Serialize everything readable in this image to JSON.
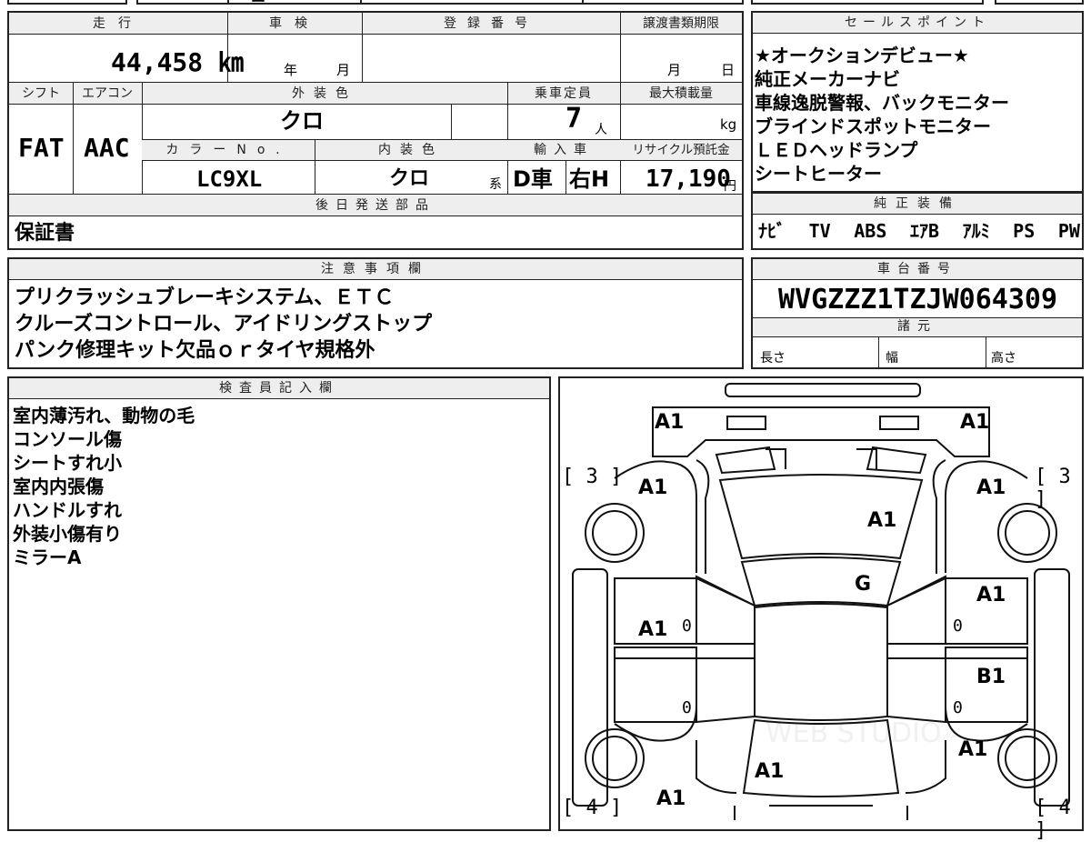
{
  "top_strip": {
    "partial_text": "ー"
  },
  "vehicle": {
    "mileage_label": "走行",
    "mileage_value": "44,458 ㎞",
    "inspection_label": "車検",
    "inspection_year": "年",
    "inspection_month": "月",
    "registration_label": "登録番号",
    "transfer_label": "譲渡書類期限",
    "transfer_month": "月",
    "transfer_day": "日",
    "shift_label": "シフト",
    "shift_value": "FAT",
    "ac_label": "エアコン",
    "ac_value": "AAC",
    "exterior_color_label": "外装色",
    "exterior_color_value": "クロ",
    "capacity_label": "乗車定員",
    "capacity_value": "7",
    "capacity_unit": "人",
    "max_load_label": "最大積載量",
    "max_load_unit": "kg",
    "color_no_label": "カラーNo.",
    "color_no_value": "LC9XL",
    "interior_color_label": "内装色",
    "interior_color_value": "クロ",
    "interior_color_suffix": "系",
    "import_label": "輸入車",
    "import_type": "D車",
    "steering": "右H",
    "recycle_label": "リサイクル預託金",
    "recycle_value": "17,190",
    "recycle_unit": "円",
    "later_parts_label": "後日発送部品",
    "later_parts_value": "保証書"
  },
  "sales_points": {
    "label": "セールスポイント",
    "lines": [
      "★オークションデビュー★",
      "純正メーカーナビ",
      "車線逸脱警報、バックモニター",
      "ブラインドスポットモニター",
      "ＬＥＤヘッドランプ",
      "シートヒーター"
    ]
  },
  "equipment": {
    "label": "純正装備",
    "items": [
      "ﾅﾋﾞ",
      "TV",
      "ABS",
      "ｴｱB",
      "ｱﾙﾐ",
      "PS",
      "PW"
    ]
  },
  "notes": {
    "label": "注意事項欄",
    "lines": [
      "プリクラッシュブレーキシステム、ＥＴＣ",
      "クルーズコントロール、アイドリングストップ",
      "パンク修理キット欠品ｏｒタイヤ規格外"
    ]
  },
  "chassis": {
    "label": "車台番号",
    "value": "WVGZZZ1TZJW064309"
  },
  "specs": {
    "label": "諸元",
    "length": "長さ",
    "width": "幅",
    "height": "高さ"
  },
  "inspector": {
    "label": "検査員記入欄",
    "lines": [
      "室内薄汚れ、動物の毛",
      "コンソール傷",
      "シートすれ小",
      "室内内張傷",
      "ハンドルすれ",
      "外装小傷有り",
      "ミラーA"
    ]
  },
  "diagram": {
    "tread_left_front": "[ 3 ]",
    "tread_right_front": "[ 3 ]",
    "tread_left_rear": "[ 4 ]",
    "tread_right_rear": "[ 4 ]",
    "grades": {
      "front_left_corner": "A1",
      "front_right_corner": "A1",
      "left_front_fender": "A1",
      "right_front_fender": "A1",
      "hood": "A1",
      "windshield": "G",
      "left_front_door": "A1",
      "right_front_door": "A1",
      "right_rear_door": "B1",
      "right_rear_fender": "A1",
      "roof_rear": "A1",
      "rear_left": "A1",
      "door_marker": "0"
    },
    "watermark": "WEB STUDIO"
  }
}
